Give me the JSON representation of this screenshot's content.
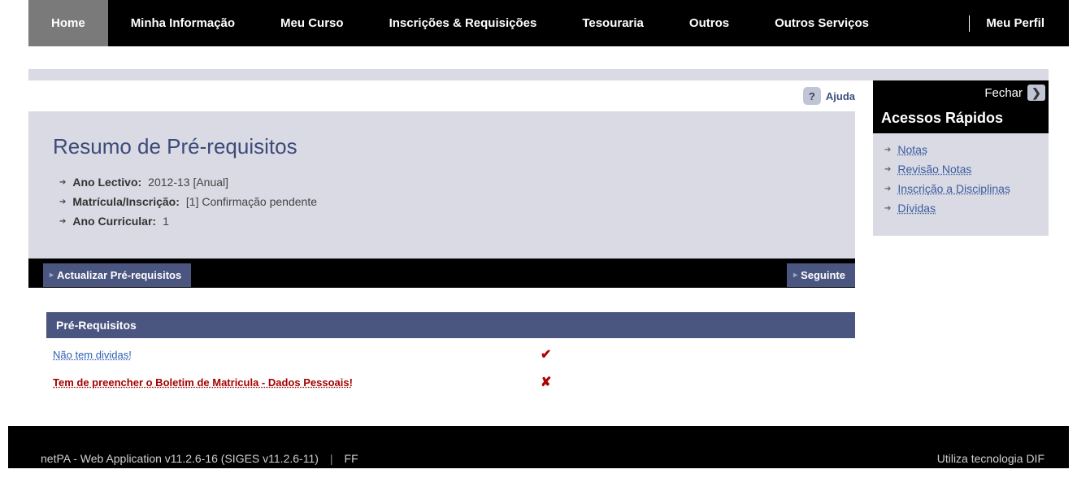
{
  "nav": {
    "home": "Home",
    "info": "Minha Informação",
    "curso": "Meu Curso",
    "inscr": "Inscrições & Requisições",
    "tesour": "Tesouraria",
    "outros": "Outros",
    "outserv": "Outros Serviços",
    "perfil": "Meu Perfil"
  },
  "help": {
    "label": "Ajuda",
    "icon": "?"
  },
  "summary": {
    "title": "Resumo de Pré-requisitos",
    "ano_lectivo_label": "Ano Lectivo:",
    "ano_lectivo_value": "2012-13 [Anual]",
    "matricula_label": "Matrícula/Inscrição:",
    "matricula_value": "[1] Confirmação pendente",
    "ano_curricular_label": "Ano Curricular:",
    "ano_curricular_value": "1"
  },
  "actions": {
    "update": "Actualizar Pré-requisitos",
    "next": "Seguinte"
  },
  "prereq": {
    "header": "Pré-Requisitos",
    "ok_text": "Não tem dividas!",
    "ok_icon": "✔",
    "err_text": "Tem de preencher o Boletim de Matricula - Dados Pessoais!",
    "err_icon": "✘"
  },
  "sidebar": {
    "close": "Fechar",
    "title": "Acessos Rápidos",
    "items": [
      {
        "label": "Notas"
      },
      {
        "label": "Revisão Notas"
      },
      {
        "label": "Inscrição a Disciplinas"
      },
      {
        "label": "Dívidas"
      }
    ]
  },
  "footer": {
    "app": "netPA - Web Application v11.2.6-16 (SIGES v11.2.6-11)",
    "user": "FF",
    "tech": "Utiliza tecnologia DIF"
  }
}
